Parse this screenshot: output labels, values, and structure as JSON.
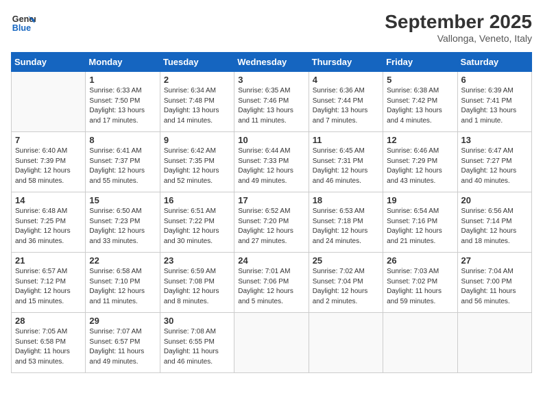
{
  "logo": {
    "line1": "General",
    "line2": "Blue"
  },
  "title": "September 2025",
  "location": "Vallonga, Veneto, Italy",
  "days_header": [
    "Sunday",
    "Monday",
    "Tuesday",
    "Wednesday",
    "Thursday",
    "Friday",
    "Saturday"
  ],
  "weeks": [
    [
      {
        "day": "",
        "info": ""
      },
      {
        "day": "1",
        "info": "Sunrise: 6:33 AM\nSunset: 7:50 PM\nDaylight: 13 hours\nand 17 minutes."
      },
      {
        "day": "2",
        "info": "Sunrise: 6:34 AM\nSunset: 7:48 PM\nDaylight: 13 hours\nand 14 minutes."
      },
      {
        "day": "3",
        "info": "Sunrise: 6:35 AM\nSunset: 7:46 PM\nDaylight: 13 hours\nand 11 minutes."
      },
      {
        "day": "4",
        "info": "Sunrise: 6:36 AM\nSunset: 7:44 PM\nDaylight: 13 hours\nand 7 minutes."
      },
      {
        "day": "5",
        "info": "Sunrise: 6:38 AM\nSunset: 7:42 PM\nDaylight: 13 hours\nand 4 minutes."
      },
      {
        "day": "6",
        "info": "Sunrise: 6:39 AM\nSunset: 7:41 PM\nDaylight: 13 hours\nand 1 minute."
      }
    ],
    [
      {
        "day": "7",
        "info": "Sunrise: 6:40 AM\nSunset: 7:39 PM\nDaylight: 12 hours\nand 58 minutes."
      },
      {
        "day": "8",
        "info": "Sunrise: 6:41 AM\nSunset: 7:37 PM\nDaylight: 12 hours\nand 55 minutes."
      },
      {
        "day": "9",
        "info": "Sunrise: 6:42 AM\nSunset: 7:35 PM\nDaylight: 12 hours\nand 52 minutes."
      },
      {
        "day": "10",
        "info": "Sunrise: 6:44 AM\nSunset: 7:33 PM\nDaylight: 12 hours\nand 49 minutes."
      },
      {
        "day": "11",
        "info": "Sunrise: 6:45 AM\nSunset: 7:31 PM\nDaylight: 12 hours\nand 46 minutes."
      },
      {
        "day": "12",
        "info": "Sunrise: 6:46 AM\nSunset: 7:29 PM\nDaylight: 12 hours\nand 43 minutes."
      },
      {
        "day": "13",
        "info": "Sunrise: 6:47 AM\nSunset: 7:27 PM\nDaylight: 12 hours\nand 40 minutes."
      }
    ],
    [
      {
        "day": "14",
        "info": "Sunrise: 6:48 AM\nSunset: 7:25 PM\nDaylight: 12 hours\nand 36 minutes."
      },
      {
        "day": "15",
        "info": "Sunrise: 6:50 AM\nSunset: 7:23 PM\nDaylight: 12 hours\nand 33 minutes."
      },
      {
        "day": "16",
        "info": "Sunrise: 6:51 AM\nSunset: 7:22 PM\nDaylight: 12 hours\nand 30 minutes."
      },
      {
        "day": "17",
        "info": "Sunrise: 6:52 AM\nSunset: 7:20 PM\nDaylight: 12 hours\nand 27 minutes."
      },
      {
        "day": "18",
        "info": "Sunrise: 6:53 AM\nSunset: 7:18 PM\nDaylight: 12 hours\nand 24 minutes."
      },
      {
        "day": "19",
        "info": "Sunrise: 6:54 AM\nSunset: 7:16 PM\nDaylight: 12 hours\nand 21 minutes."
      },
      {
        "day": "20",
        "info": "Sunrise: 6:56 AM\nSunset: 7:14 PM\nDaylight: 12 hours\nand 18 minutes."
      }
    ],
    [
      {
        "day": "21",
        "info": "Sunrise: 6:57 AM\nSunset: 7:12 PM\nDaylight: 12 hours\nand 15 minutes."
      },
      {
        "day": "22",
        "info": "Sunrise: 6:58 AM\nSunset: 7:10 PM\nDaylight: 12 hours\nand 11 minutes."
      },
      {
        "day": "23",
        "info": "Sunrise: 6:59 AM\nSunset: 7:08 PM\nDaylight: 12 hours\nand 8 minutes."
      },
      {
        "day": "24",
        "info": "Sunrise: 7:01 AM\nSunset: 7:06 PM\nDaylight: 12 hours\nand 5 minutes."
      },
      {
        "day": "25",
        "info": "Sunrise: 7:02 AM\nSunset: 7:04 PM\nDaylight: 12 hours\nand 2 minutes."
      },
      {
        "day": "26",
        "info": "Sunrise: 7:03 AM\nSunset: 7:02 PM\nDaylight: 11 hours\nand 59 minutes."
      },
      {
        "day": "27",
        "info": "Sunrise: 7:04 AM\nSunset: 7:00 PM\nDaylight: 11 hours\nand 56 minutes."
      }
    ],
    [
      {
        "day": "28",
        "info": "Sunrise: 7:05 AM\nSunset: 6:58 PM\nDaylight: 11 hours\nand 53 minutes."
      },
      {
        "day": "29",
        "info": "Sunrise: 7:07 AM\nSunset: 6:57 PM\nDaylight: 11 hours\nand 49 minutes."
      },
      {
        "day": "30",
        "info": "Sunrise: 7:08 AM\nSunset: 6:55 PM\nDaylight: 11 hours\nand 46 minutes."
      },
      {
        "day": "",
        "info": ""
      },
      {
        "day": "",
        "info": ""
      },
      {
        "day": "",
        "info": ""
      },
      {
        "day": "",
        "info": ""
      }
    ]
  ]
}
